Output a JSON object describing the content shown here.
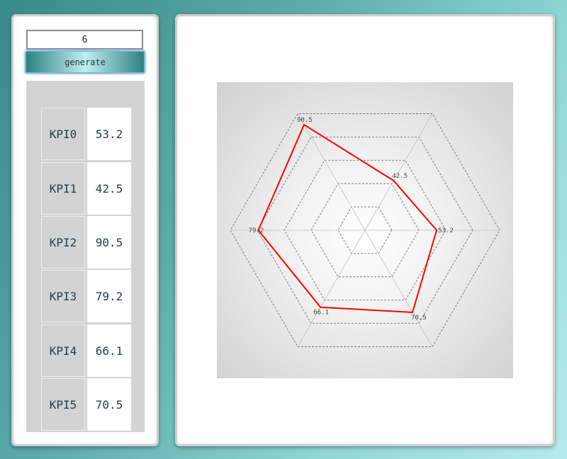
{
  "controls": {
    "count_value": "6",
    "generate_label": "generate"
  },
  "chart_data": {
    "type": "radar",
    "categories": [
      "KPI0",
      "KPI1",
      "KPI2",
      "KPI3",
      "KPI4",
      "KPI5"
    ],
    "values": [
      53.2,
      42.5,
      90.5,
      79.2,
      66.1,
      70.5
    ],
    "value_labels": [
      "53.2",
      "42.5",
      "90.5",
      "79.2",
      "66.1",
      "70.5"
    ],
    "rlim": [
      0,
      100
    ],
    "rings": 5,
    "series_color": "#ff0000",
    "grid_color": "#666666"
  }
}
